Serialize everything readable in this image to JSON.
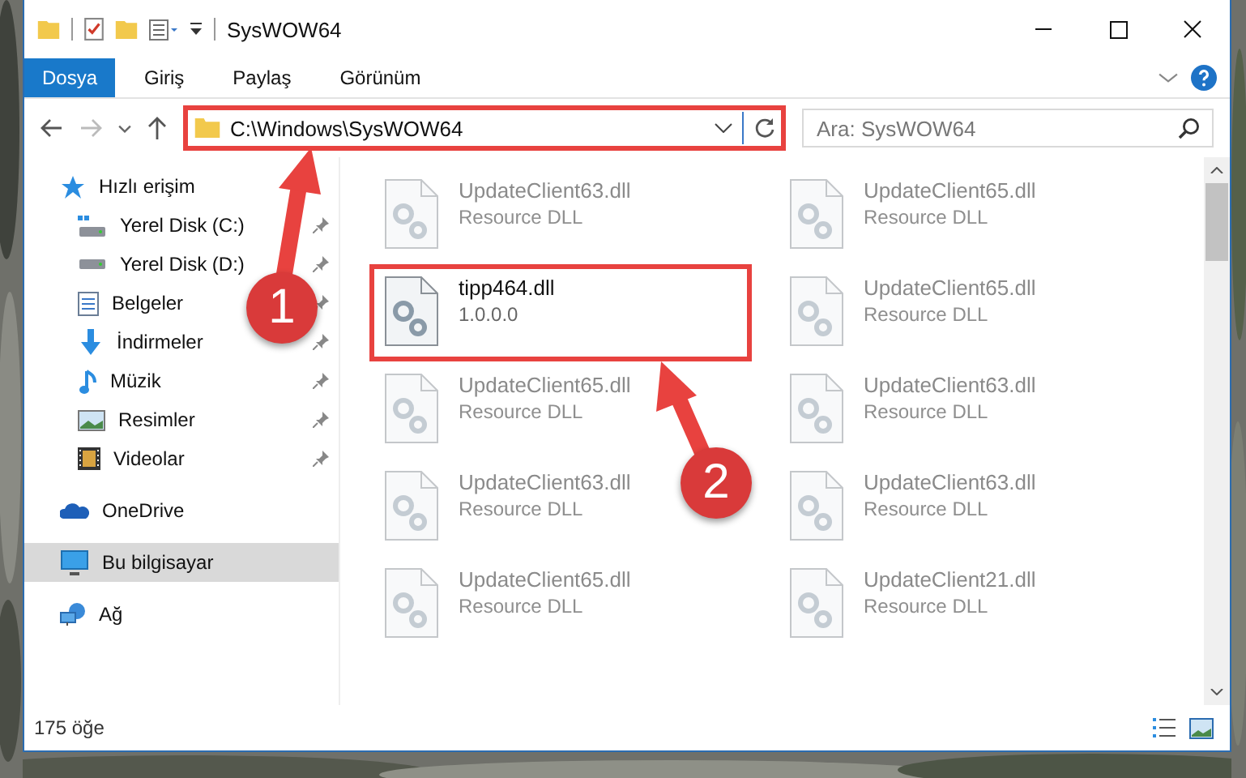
{
  "window": {
    "title": "SysWOW64"
  },
  "ribbon_tabs": [
    {
      "label": "Dosya",
      "kind": "file",
      "selected": false
    },
    {
      "label": "Giriş",
      "kind": "tab",
      "selected": false
    },
    {
      "label": "Paylaş",
      "kind": "tab",
      "selected": false
    },
    {
      "label": "Görünüm",
      "kind": "tab",
      "selected": false
    }
  ],
  "address_bar": {
    "path": "C:\\Windows\\SysWOW64",
    "marked": true
  },
  "search": {
    "placeholder": "Ara: SysWOW64"
  },
  "sidebar": {
    "items": [
      {
        "label": "Hızlı erişim",
        "selected": false,
        "children": [
          {
            "label": "Yerel Disk (C:)",
            "pinned": true,
            "selected": false
          },
          {
            "label": "Yerel Disk (D:)",
            "pinned": true,
            "selected": false
          },
          {
            "label": "Belgeler",
            "pinned": true,
            "selected": false
          },
          {
            "label": "İndirmeler",
            "pinned": true,
            "selected": false
          },
          {
            "label": "Müzik",
            "pinned": true,
            "selected": false
          },
          {
            "label": "Resimler",
            "pinned": true,
            "selected": false
          },
          {
            "label": "Videolar",
            "pinned": true,
            "selected": false
          }
        ]
      },
      {
        "label": "OneDrive",
        "selected": false
      },
      {
        "label": "Bu bilgisayar",
        "selected": true
      },
      {
        "label": "Ağ",
        "selected": false
      }
    ]
  },
  "files": [
    {
      "name": "UpdateClient63.dll",
      "detail": "Resource DLL",
      "dimmed": true,
      "marked": false
    },
    {
      "name": "UpdateClient65.dll",
      "detail": "Resource DLL",
      "dimmed": true,
      "marked": false
    },
    {
      "name": "tipp464.dll",
      "detail": "1.0.0.0",
      "dimmed": false,
      "marked": true
    },
    {
      "name": "UpdateClient65.dll",
      "detail": "Resource DLL",
      "dimmed": true,
      "marked": false
    },
    {
      "name": "UpdateClient65.dll",
      "detail": "Resource DLL",
      "dimmed": true,
      "marked": false
    },
    {
      "name": "UpdateClient63.dll",
      "detail": "Resource DLL",
      "dimmed": true,
      "marked": false
    },
    {
      "name": "UpdateClient63.dll",
      "detail": "Resource DLL",
      "dimmed": true,
      "marked": false
    },
    {
      "name": "UpdateClient63.dll",
      "detail": "Resource DLL",
      "dimmed": true,
      "marked": false
    },
    {
      "name": "UpdateClient65.dll",
      "detail": "Resource DLL",
      "dimmed": true,
      "marked": false
    },
    {
      "name": "UpdateClient21.dll",
      "detail": "Resource DLL",
      "dimmed": true,
      "marked": false
    }
  ],
  "status_bar": {
    "count": "175 öğe"
  },
  "annotations": [
    {
      "label": "1"
    },
    {
      "label": "2"
    }
  ]
}
